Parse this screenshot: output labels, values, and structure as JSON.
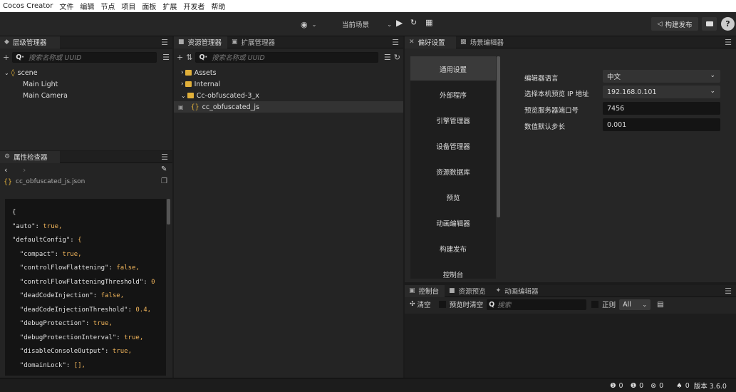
{
  "menubar": {
    "items": [
      "Cocos Creator",
      "文件",
      "编辑",
      "节点",
      "项目",
      "面板",
      "扩展",
      "开发者",
      "帮助"
    ]
  },
  "toolbar": {
    "scene_select": "当前场景",
    "build_label": "构建发布"
  },
  "hierarchy": {
    "tab": "层级管理器",
    "search_placeholder": "搜索名称或 UUID",
    "search_prefix": "Q·",
    "nodes": [
      "scene",
      "Main Light",
      "Main Camera"
    ]
  },
  "assets": {
    "tabs": [
      "资源管理器",
      "扩展管理器"
    ],
    "search_placeholder": "搜索名称或 UUID",
    "search_prefix": "Q·",
    "items": [
      "Assets",
      "Internal",
      "Cc-obfuscated-3_x",
      "cc_obfuscated_js"
    ]
  },
  "inspector": {
    "tab": "属性检查器",
    "file_name": "cc_obfuscated_js.json",
    "code_lines": [
      [
        "{",
        ""
      ],
      [
        "\"auto\": ",
        "true,"
      ],
      [
        "\"defaultConfig\": ",
        "{"
      ],
      [
        "  \"compact\": ",
        "true,"
      ],
      [
        "  \"controlFlowFlattening\": ",
        "false,"
      ],
      [
        "  \"controlFlowFlatteningThreshold\": ",
        "0"
      ],
      [
        "  \"deadCodeInjection\": ",
        "false,"
      ],
      [
        "  \"deadCodeInjectionThreshold\": ",
        "0.4,"
      ],
      [
        "  \"debugProtection\": ",
        "true,"
      ],
      [
        "  \"debugProtectionInterval\": ",
        "true,"
      ],
      [
        "  \"disableConsoleOutput\": ",
        "true,"
      ],
      [
        "  \"domainLock\": ",
        "[],"
      ]
    ]
  },
  "preferences": {
    "tabs": [
      "偏好设置",
      "场景编辑器"
    ],
    "nav": [
      "通用设置",
      "外部程序",
      "引擎管理器",
      "设备管理器",
      "资源数据库",
      "预览",
      "动画编辑器",
      "构建发布",
      "控制台"
    ],
    "fields": [
      {
        "label": "编辑器语言",
        "value": "中文"
      },
      {
        "label": "选择本机预览 IP 地址",
        "value": "192.168.0.101"
      },
      {
        "label": "预览服务器端口号",
        "value": "7456"
      },
      {
        "label": "数值默认步长",
        "value": "0.001"
      }
    ]
  },
  "console": {
    "tabs": [
      "控制台",
      "资源预览",
      "动画编辑器"
    ],
    "clear_label": "清空",
    "clear_on_preview_label": "预览时清空",
    "search_placeholder": "搜索",
    "regex_label": "正则",
    "level_select": "All"
  },
  "statusbar": {
    "info_count": "0",
    "warn_count": "0",
    "error_count": "0",
    "notify_count": "0",
    "version": "版本 3.6.0"
  },
  "colors": {
    "accent": "#e1b03a",
    "panel_bg": "#242424",
    "field_bg": "#141414"
  }
}
